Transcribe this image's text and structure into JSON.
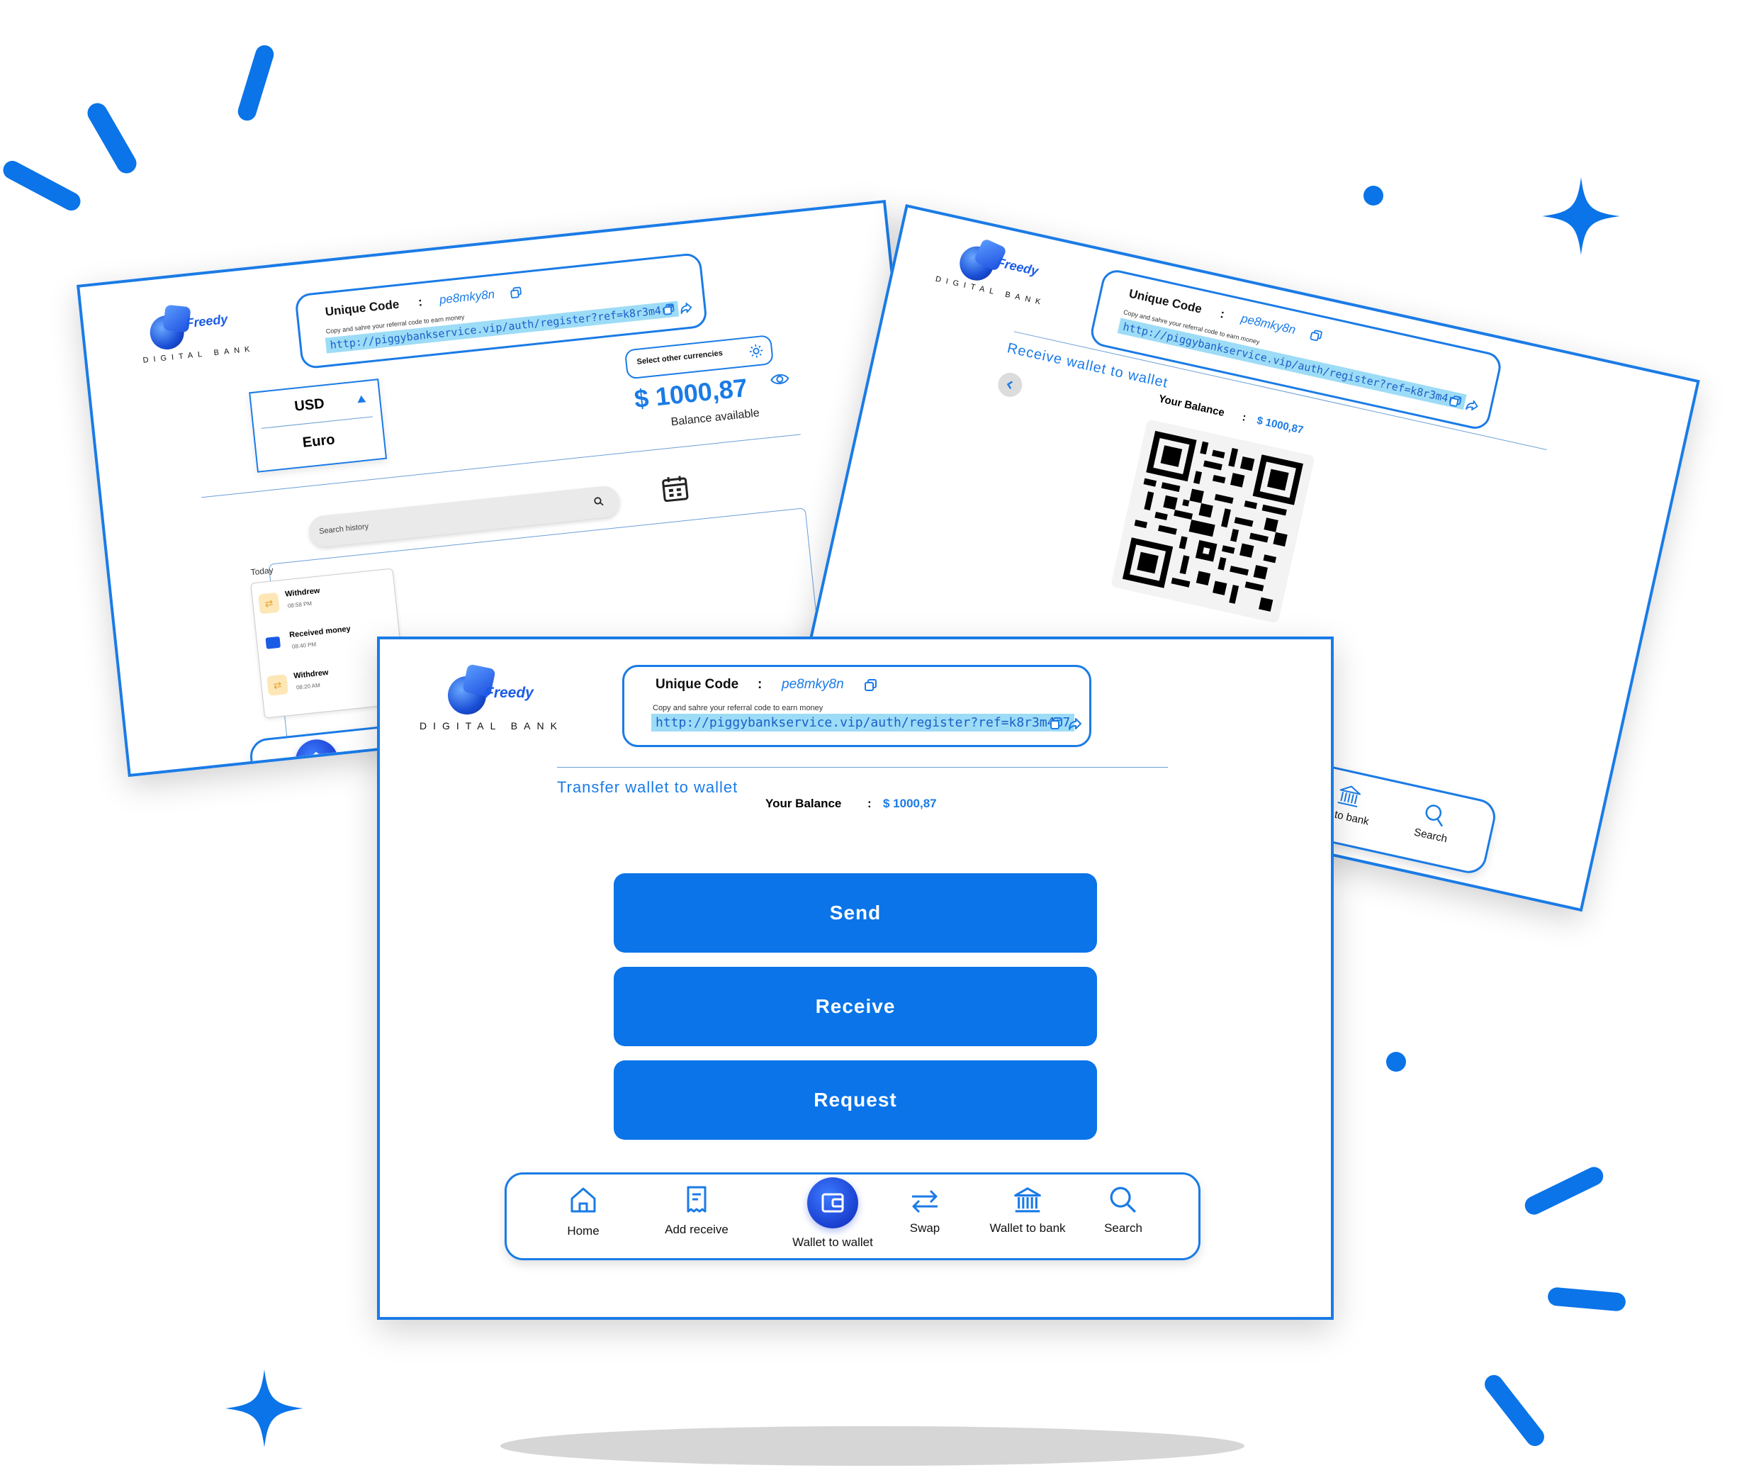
{
  "brand": {
    "name": "Freedy",
    "tagline": "DIGITAL BANK"
  },
  "referral": {
    "unique_code_label": "Unique Code",
    "separator": ":",
    "code": "pe8mky8n",
    "hint": "Copy and sahre your referral code to earn money",
    "link": "http://piggybankservice.vip/auth/register?ref=k8r3m4r7"
  },
  "balance": {
    "label": "Your Balance",
    "separator": ":",
    "amount": "$ 1000,87",
    "big_amount": "$ 1000,87",
    "available_label": "Balance available"
  },
  "currencies": {
    "select_other_label": "Select other currencies",
    "options": [
      "USD",
      "Euro"
    ],
    "selected": "USD"
  },
  "history": {
    "search_placeholder": "Search history",
    "group_label": "Today",
    "items": [
      {
        "title": "Withdrew",
        "time": "08:58 PM",
        "icon": "transfer-icon"
      },
      {
        "title": "Received money",
        "time": "08:40 PM",
        "icon": "wallet-icon"
      },
      {
        "title": "Withdrew",
        "time": "08:20 AM",
        "icon": "transfer-icon"
      }
    ]
  },
  "receive_screen": {
    "title": "Receive wallet to wallet"
  },
  "transfer_screen": {
    "title": "Transfer wallet to wallet",
    "actions": {
      "send": "Send",
      "receive": "Receive",
      "request": "Request"
    }
  },
  "nav": {
    "home": "Home",
    "add_receive": "Add receive",
    "wallet_to_wallet": "Wallet to wallet",
    "swap": "Swap",
    "wallet_to_bank": "Wallet to bank",
    "search": "Search",
    "wallet_to_bank_partial": "let to bank",
    "active": "Wallet to wallet"
  },
  "colors": {
    "accent": "#0A74E8",
    "border": "#1A7BE6",
    "link_highlight": "#9ddcf7",
    "background": "#ffffff"
  }
}
